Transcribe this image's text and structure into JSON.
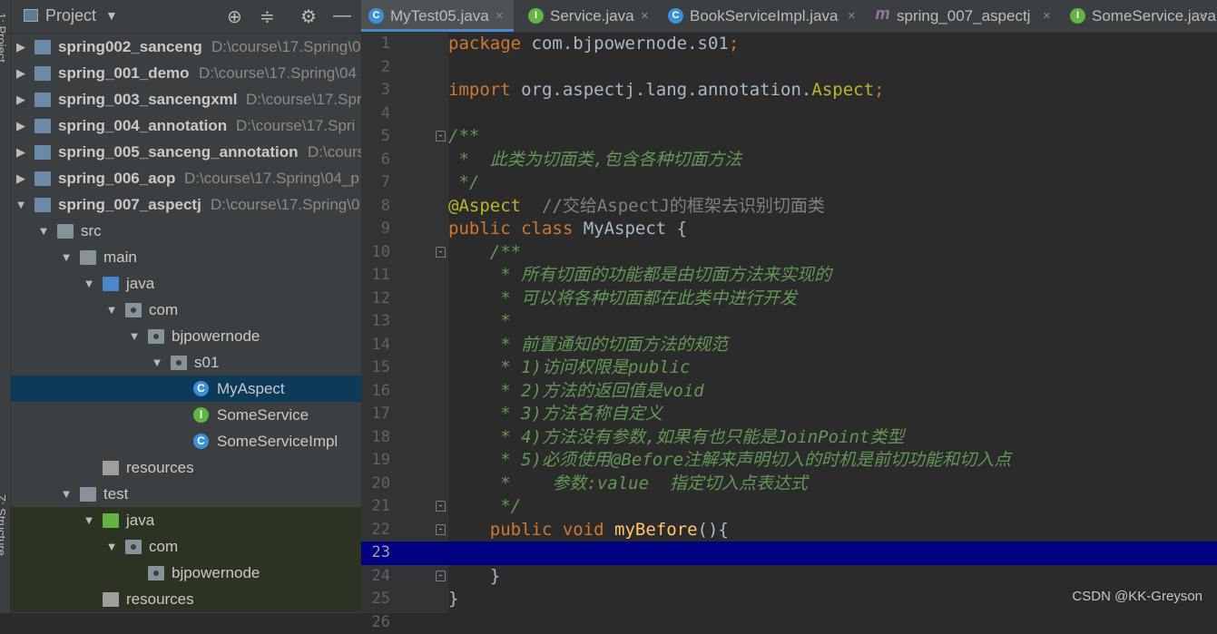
{
  "sidebar": {
    "project_label": "1: Project",
    "structure_label": "Z: Structure"
  },
  "project_panel": {
    "title": "Project",
    "toolbar": {
      "locate_icon": "crosshair-icon",
      "collapse_icon": "collapse-all-icon",
      "settings_icon": "gear-icon",
      "hide_icon": "minimize-icon"
    },
    "tree": [
      {
        "label": "spring002_sanceng",
        "path": "D:\\course\\17.Spring\\0",
        "depth": 0,
        "arrow": "▶",
        "icon": "module-folder",
        "bold": true
      },
      {
        "label": "spring_001_demo",
        "path": "D:\\course\\17.Spring\\04",
        "depth": 0,
        "arrow": "▶",
        "icon": "module-folder",
        "bold": true
      },
      {
        "label": "spring_003_sancengxml",
        "path": "D:\\course\\17.Spr",
        "depth": 0,
        "arrow": "▶",
        "icon": "module-folder",
        "bold": true
      },
      {
        "label": "spring_004_annotation",
        "path": "D:\\course\\17.Spri",
        "depth": 0,
        "arrow": "▶",
        "icon": "module-folder",
        "bold": true
      },
      {
        "label": "spring_005_sanceng_annotation",
        "path": "D:\\cours",
        "depth": 0,
        "arrow": "▶",
        "icon": "module-folder",
        "bold": true
      },
      {
        "label": "spring_006_aop",
        "path": "D:\\course\\17.Spring\\04_p",
        "depth": 0,
        "arrow": "▶",
        "icon": "module-folder",
        "bold": true
      },
      {
        "label": "spring_007_aspectj",
        "path": "D:\\course\\17.Spring\\0",
        "depth": 0,
        "arrow": "▼",
        "icon": "module-folder",
        "bold": true
      },
      {
        "label": "src",
        "path": "",
        "depth": 1,
        "arrow": "▼",
        "icon": "folder",
        "bold": false
      },
      {
        "label": "main",
        "path": "",
        "depth": 2,
        "arrow": "▼",
        "icon": "folder",
        "bold": false
      },
      {
        "label": "java",
        "path": "",
        "depth": 3,
        "arrow": "▼",
        "icon": "source-folder",
        "bold": false
      },
      {
        "label": "com",
        "path": "",
        "depth": 4,
        "arrow": "▼",
        "icon": "package",
        "bold": false
      },
      {
        "label": "bjpowernode",
        "path": "",
        "depth": 5,
        "arrow": "▼",
        "icon": "package",
        "bold": false
      },
      {
        "label": "s01",
        "path": "",
        "depth": 6,
        "arrow": "▼",
        "icon": "package",
        "bold": false
      },
      {
        "label": "MyAspect",
        "path": "",
        "depth": 7,
        "arrow": "",
        "icon": "class",
        "bold": false,
        "selected": true
      },
      {
        "label": "SomeService",
        "path": "",
        "depth": 7,
        "arrow": "",
        "icon": "interface",
        "bold": false
      },
      {
        "label": "SomeServiceImpl",
        "path": "",
        "depth": 7,
        "arrow": "",
        "icon": "class",
        "bold": false
      },
      {
        "label": "resources",
        "path": "",
        "depth": 3,
        "arrow": "",
        "icon": "resources-folder",
        "bold": false
      },
      {
        "label": "test",
        "path": "",
        "depth": 2,
        "arrow": "▼",
        "icon": "folder",
        "bold": false
      },
      {
        "label": "java",
        "path": "",
        "depth": 3,
        "arrow": "▼",
        "icon": "test-folder",
        "bold": false,
        "test": true
      },
      {
        "label": "com",
        "path": "",
        "depth": 4,
        "arrow": "▼",
        "icon": "package",
        "bold": false,
        "test": true
      },
      {
        "label": "bjpowernode",
        "path": "",
        "depth": 5,
        "arrow": "",
        "icon": "package",
        "bold": false,
        "test": true
      },
      {
        "label": "resources",
        "path": "",
        "depth": 3,
        "arrow": "",
        "icon": "test-resources-folder",
        "bold": false,
        "test": true
      }
    ]
  },
  "tabs": [
    {
      "label": "MyTest05.java",
      "icon": "class-icon",
      "active": true
    },
    {
      "label": "Service.java",
      "icon": "interface-icon",
      "active": false
    },
    {
      "label": "BookServiceImpl.java",
      "icon": "class-icon",
      "active": false
    },
    {
      "label": "spring_007_aspectj",
      "icon": "maven-icon",
      "active": false
    },
    {
      "label": "SomeService.java",
      "icon": "interface-icon",
      "active": false
    }
  ],
  "tab_close_glyph": "×",
  "editor": {
    "current_line": 23,
    "lines": [
      {
        "n": "1",
        "tokens": [
          [
            "kw",
            "package "
          ],
          [
            "id",
            "com.bjpowernode.s01"
          ],
          [
            "kw",
            ";"
          ]
        ]
      },
      {
        "n": "2",
        "tokens": []
      },
      {
        "n": "3",
        "tokens": [
          [
            "kw",
            "import "
          ],
          [
            "id",
            "org.aspectj.lang.annotation."
          ],
          [
            "ann",
            "Aspect"
          ],
          [
            "kw",
            ";"
          ]
        ]
      },
      {
        "n": "4",
        "tokens": []
      },
      {
        "n": "5",
        "fold": true,
        "tokens": [
          [
            "cm",
            "/**"
          ]
        ]
      },
      {
        "n": "6",
        "tokens": [
          [
            "cm",
            " *  此类为切面类,包含各种切面方法"
          ]
        ]
      },
      {
        "n": "7",
        "tokens": [
          [
            "cm",
            " */"
          ]
        ]
      },
      {
        "n": "8",
        "tokens": [
          [
            "ann",
            "@Aspect"
          ],
          [
            "id",
            "  "
          ],
          [
            "lc",
            "//交给AspectJ的框架去识别切面类"
          ]
        ]
      },
      {
        "n": "9",
        "tokens": [
          [
            "kw",
            "public class "
          ],
          [
            "id",
            "MyAspect {"
          ]
        ]
      },
      {
        "n": "10",
        "fold": true,
        "tokens": [
          [
            "cm",
            "    /**"
          ]
        ]
      },
      {
        "n": "11",
        "tokens": [
          [
            "cm",
            "     * 所有切面的功能都是由切面方法来实现的"
          ]
        ]
      },
      {
        "n": "12",
        "tokens": [
          [
            "cm",
            "     * 可以将各种切面都在此类中进行开发"
          ]
        ]
      },
      {
        "n": "13",
        "tokens": [
          [
            "cm",
            "     *"
          ]
        ]
      },
      {
        "n": "14",
        "tokens": [
          [
            "cm",
            "     * 前置通知的切面方法的规范"
          ]
        ]
      },
      {
        "n": "15",
        "tokens": [
          [
            "cm",
            "     * 1)访问权限是public"
          ]
        ]
      },
      {
        "n": "16",
        "tokens": [
          [
            "cm",
            "     * 2)方法的返回值是void"
          ]
        ]
      },
      {
        "n": "17",
        "tokens": [
          [
            "cm",
            "     * 3)方法名称自定义"
          ]
        ]
      },
      {
        "n": "18",
        "tokens": [
          [
            "cm",
            "     * 4)方法没有参数,如果有也只能是JoinPoint类型"
          ]
        ]
      },
      {
        "n": "19",
        "tokens": [
          [
            "cm",
            "     * 5)必须使用@Before注解来声明切入的时机是前切功能和切入点"
          ]
        ]
      },
      {
        "n": "20",
        "tokens": [
          [
            "cm",
            "     *    参数:value  指定切入点表达式"
          ]
        ]
      },
      {
        "n": "21",
        "fold": true,
        "tokens": [
          [
            "cm",
            "     */"
          ]
        ]
      },
      {
        "n": "22",
        "fold": true,
        "tokens": [
          [
            "kw",
            "    public void "
          ],
          [
            "mcall",
            "myBefore"
          ],
          [
            "id",
            "(){"
          ]
        ]
      },
      {
        "n": "23",
        "tokens": []
      },
      {
        "n": "24",
        "fold": true,
        "tokens": [
          [
            "id",
            "    }"
          ]
        ]
      },
      {
        "n": "25",
        "tokens": [
          [
            "id",
            "}"
          ]
        ]
      },
      {
        "n": "26",
        "tokens": []
      }
    ]
  },
  "watermark": "CSDN @KK-Greyson"
}
